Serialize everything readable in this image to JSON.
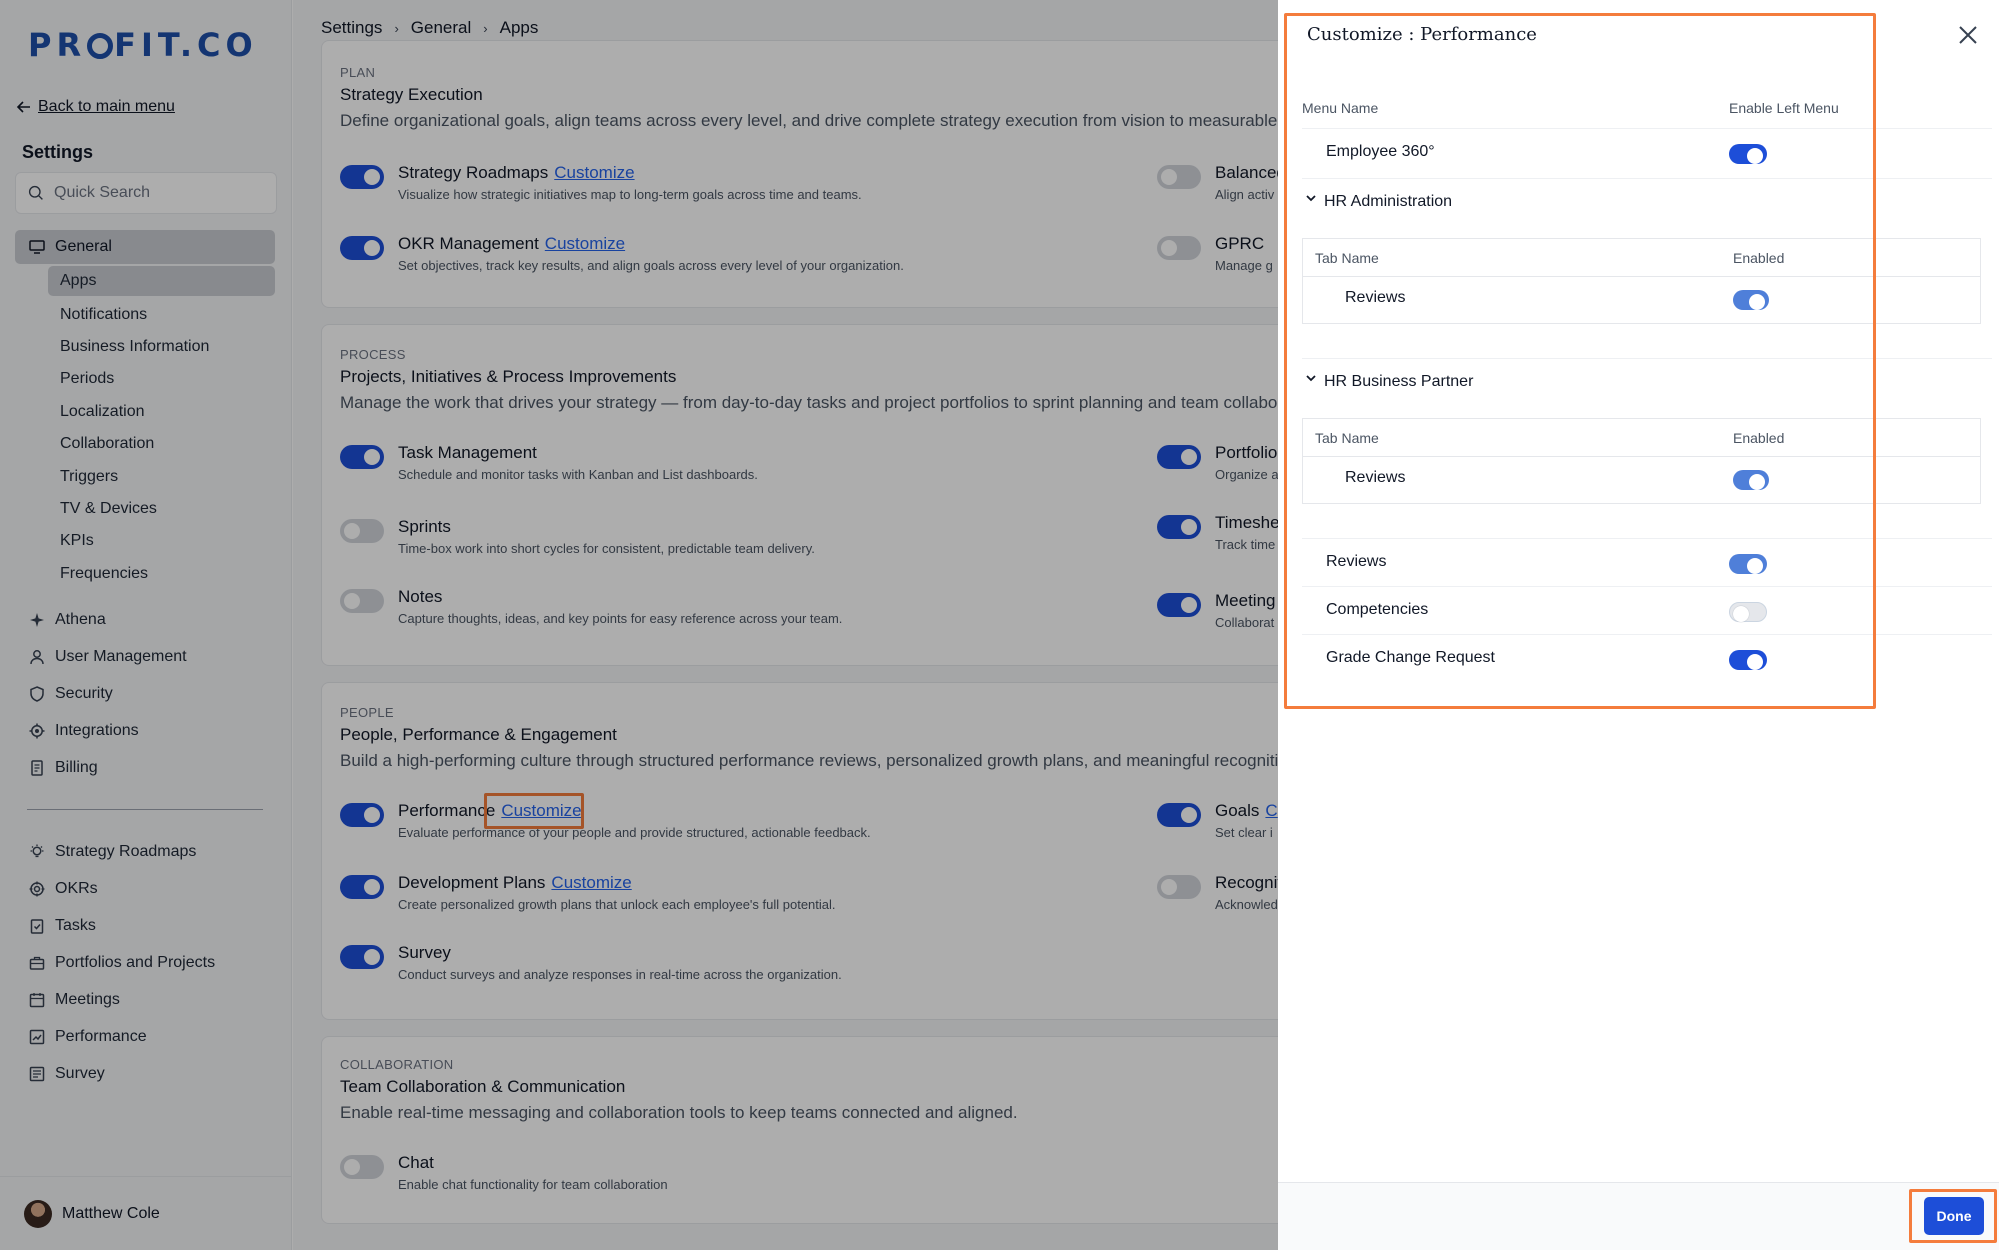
{
  "brand": {
    "logo_text_a": "PR",
    "logo_text_b": "FIT.CO"
  },
  "sidebar": {
    "back_label": "Back to main menu",
    "title": "Settings",
    "search_placeholder": "Quick Search",
    "group_label": "General",
    "sub_items": [
      "Apps",
      "Notifications",
      "Business Information",
      "Periods",
      "Localization",
      "Collaboration",
      "Triggers",
      "TV & Devices",
      "KPIs",
      "Frequencies"
    ],
    "items": [
      "Athena",
      "User Management",
      "Security",
      "Integrations",
      "Billing"
    ],
    "apps": [
      "Strategy Roadmaps",
      "OKRs",
      "Tasks",
      "Portfolios and Projects",
      "Meetings",
      "Performance",
      "Survey"
    ],
    "user_name": "Matthew Cole"
  },
  "breadcrumb": [
    "Settings",
    "General",
    "Apps"
  ],
  "sections": {
    "plan": {
      "category": "PLAN",
      "title": "Strategy Execution",
      "desc": "Define organizational goals, align teams across every level, and drive complete strategy execution from vision to measurable outcomes.",
      "apps": [
        {
          "name": "Strategy Roadmaps",
          "link": "Customize",
          "desc": "Visualize how strategic initiatives map to long-term goals across time and teams."
        },
        {
          "name": "OKR Management",
          "link": "Customize",
          "desc": "Set objectives, track key results, and align goals across every level of your organization."
        },
        {
          "name": "Balanced",
          "desc": "Align activ"
        },
        {
          "name": "GPRC",
          "desc": "Manage g"
        }
      ]
    },
    "process": {
      "category": "PROCESS",
      "title": "Projects, Initiatives & Process Improvements",
      "desc": "Manage the work that drives your strategy — from day-to-day tasks and project portfolios to sprint planning and team collaboration.",
      "apps": [
        {
          "name": "Task Management",
          "desc": "Schedule and monitor tasks with Kanban and List dashboards."
        },
        {
          "name": "Sprints",
          "desc": "Time-box work into short cycles for consistent, predictable team delivery."
        },
        {
          "name": "Notes",
          "desc": "Capture thoughts, ideas, and key points for easy reference across your team."
        },
        {
          "name": "Portfolio",
          "desc": "Organize a"
        },
        {
          "name": "Timeshe",
          "desc": "Track time"
        },
        {
          "name": "Meeting",
          "desc": "Collaborat"
        }
      ]
    },
    "people": {
      "category": "PEOPLE",
      "title": "People, Performance & Engagement",
      "desc": "Build a high-performing culture through structured performance reviews, personalized growth plans, and meaningful recognition programs.",
      "apps": [
        {
          "name": "Performance",
          "link": "Customize",
          "desc": "Evaluate performance of your people and provide structured, actionable feedback."
        },
        {
          "name": "Development Plans",
          "link": "Customize",
          "desc": "Create personalized growth plans that unlock each employee's full potential."
        },
        {
          "name": "Survey",
          "desc": "Conduct surveys and analyze responses in real-time across the organization."
        },
        {
          "name": "Goals",
          "link": "C",
          "desc": "Set clear i"
        },
        {
          "name": "Recognit",
          "desc": "Acknowled"
        }
      ]
    },
    "collab": {
      "category": "COLLABORATION",
      "title": "Team Collaboration & Communication",
      "desc": "Enable real-time messaging and collaboration tools to keep teams connected and aligned.",
      "apps": [
        {
          "name": "Chat",
          "desc": "Enable chat functionality for team collaboration"
        }
      ]
    }
  },
  "drawer": {
    "title": "Customize : Performance",
    "col_menu": "Menu Name",
    "col_enable": "Enable Left Menu",
    "employee360": "Employee 360°",
    "hr_admin": "HR Administration",
    "hr_bp": "HR Business Partner",
    "tab_col_name": "Tab Name",
    "tab_col_enabled": "Enabled",
    "tab_reviews": "Reviews",
    "reviews": "Reviews",
    "competencies": "Competencies",
    "grade_change": "Grade Change Request",
    "done": "Done"
  }
}
